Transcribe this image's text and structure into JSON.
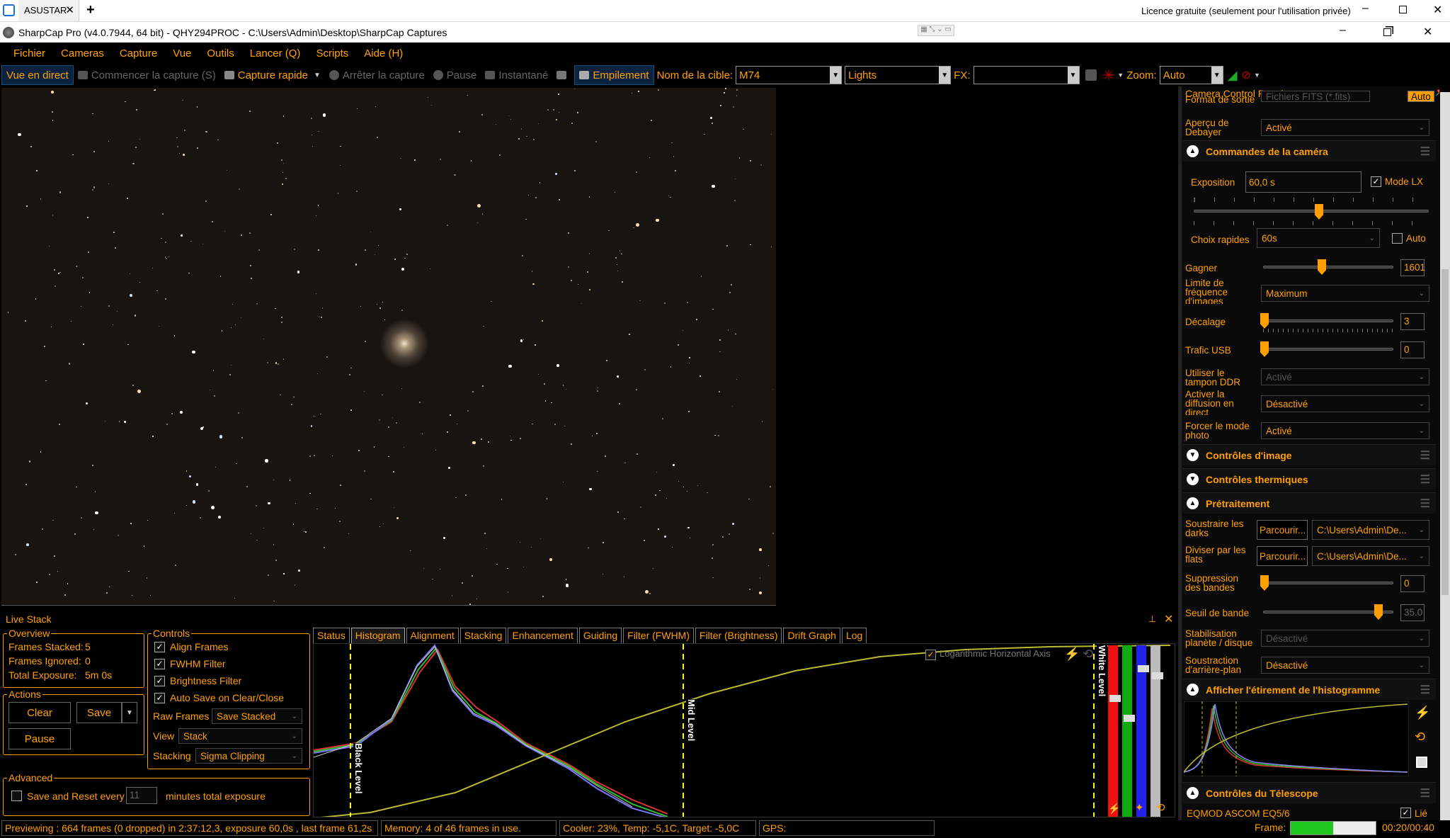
{
  "window": {
    "tab_title": "ASUSTAR",
    "license": "Licence gratuite (seulement pour l'utilisation privée)",
    "title": "SharpCap Pro (v4.0.7944, 64 bit) - QHY294PROC - C:\\Users\\Admin\\Desktop\\SharpCap Captures"
  },
  "menu": [
    "Fichier",
    "Cameras",
    "Capture",
    "Vue",
    "Outils",
    "Lancer (Q)",
    "Scripts",
    "Aide (H)"
  ],
  "toolbar": {
    "live": "Vue en direct",
    "start_capture": "Commencer la capture (S)",
    "quick_capture": "Capture rapide",
    "stop_capture": "Arrêter la capture",
    "pause": "Pause",
    "snapshot": "Instantané",
    "stacking": "Empilement",
    "target_label": "Nom de la cible:",
    "target_value": "M74",
    "frame_type": "Lights",
    "fx_label": "FX:",
    "fx_value": "",
    "zoom_label": "Zoom:",
    "zoom_value": "Auto"
  },
  "panel": {
    "title": "Camera Control Panel",
    "output_format_label": "Format de sortie",
    "output_format_value": "Fichiers FITS (*.fits)",
    "output_format_auto": "Auto",
    "debayer_label": "Aperçu de Debayer",
    "debayer_value": "Activé",
    "camera_controls": "Commandes de la caméra",
    "exposure_label": "Exposition",
    "exposure_value": "60,0 s",
    "lx_mode": "Mode LX",
    "quick_choice_label": "Choix rapides",
    "quick_choice_value": "60s",
    "auto": "Auto",
    "gain_label": "Gagner",
    "gain_value": "1601",
    "fps_limit_label": "Limite de fréquence d'images",
    "fps_limit_value": "Maximum",
    "offset_label": "Décalage",
    "offset_value": "3",
    "usb_label": "Trafic USB",
    "usb_value": "0",
    "ddr_label": "Utiliser le tampon DDR",
    "ddr_value": "Activé",
    "stream_label": "Activer la diffusion en direct",
    "stream_value": "Désactivé",
    "still_label": "Forcer le mode photo",
    "still_value": "Activé",
    "image_controls": "Contrôles d'image",
    "thermal_controls": "Contrôles thermiques",
    "preprocessing": "Prétraitement",
    "darks_label": "Soustraire les darks",
    "darks_browse": "Parcourir...",
    "darks_path": "C:\\Users\\Admin\\De...",
    "flats_label": "Diviser par les flats",
    "flats_browse": "Parcourir...",
    "flats_path": "C:\\Users\\Admin\\De...",
    "banding_label": "Suppression des bandes",
    "banding_value": "0",
    "band_threshold_label": "Seuil de bande",
    "band_threshold_value": "35.0",
    "stabilization_label": "Stabilisation planète / disque",
    "stabilization_value": "Désactivé",
    "bg_sub_label": "Soustraction d'arrière-plan",
    "bg_sub_value": "Désactivé",
    "histogram_stretch": "Afficher l'étirement de l'histogramme",
    "telescope_controls": "Contrôles du Télescope",
    "mount": "EQMOD ASCOM EQ5/6",
    "mount_check": "Lié"
  },
  "livestack": {
    "title": "Live Stack",
    "overview": "Overview",
    "frames_stacked": "Frames Stacked:",
    "frames_stacked_val": "5",
    "frames_ignored": "Frames Ignored:",
    "frames_ignored_val": "0",
    "total_exposure": "Total Exposure:",
    "total_exposure_val": "5m 0s",
    "actions": "Actions",
    "clear": "Clear",
    "save": "Save",
    "pause": "Pause",
    "advanced": "Advanced",
    "save_reset": "Save and Reset every",
    "minutes_val": "11",
    "minutes_text": "minutes total exposure",
    "controls": "Controls",
    "align": "Align Frames",
    "fwhm": "FWHM Filter",
    "brightness": "Brightness Filter",
    "autosave": "Auto Save on Clear/Close",
    "raw_label": "Raw Frames",
    "raw_value": "Save Stacked",
    "view_label": "View",
    "view_value": "Stack",
    "stacking_label": "Stacking",
    "stacking_value": "Sigma Clipping",
    "tabs": [
      "Status",
      "Histogram",
      "Alignment",
      "Stacking",
      "Enhancement",
      "Guiding",
      "Filter (FWHM)",
      "Filter (Brightness)",
      "Drift Graph",
      "Log"
    ],
    "log_axis": "Logarithmic Horizontal Axis",
    "black_level": "Black Level",
    "mid_level": "Mid Level",
    "white_level": "White Level"
  },
  "status": {
    "preview": "Previewing : 664 frames (0 dropped) in 2:37:12,3, exposure 60,0s , last frame 61,2s",
    "memory": "Memory: 4 of 46 frames in use.",
    "cooler": "Cooler: 23%, Temp: -5,1C, Target: -5,0C",
    "gps": "GPS:",
    "frame_label": "Frame:",
    "frame_time": "00:20/00:40",
    "frame_progress": 0.5
  }
}
